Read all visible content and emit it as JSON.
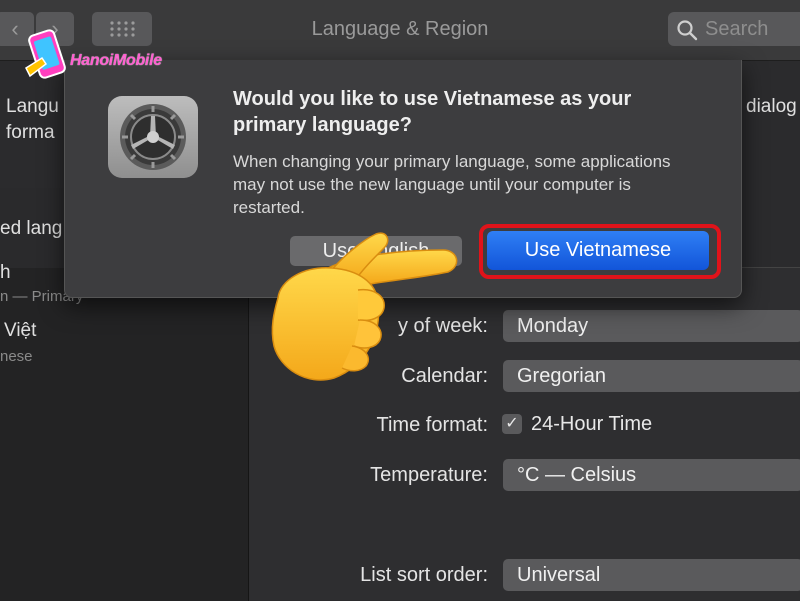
{
  "window": {
    "title": "Language & Region",
    "search_placeholder": "Search"
  },
  "watermark": {
    "brand": "HanoiMobile"
  },
  "background": {
    "header_line1": "Langu",
    "header_line2": "forma",
    "header_right": "dialog",
    "sidebar_heading": "ed lang",
    "languages": [
      {
        "name": "h",
        "sub": "n — Primary"
      },
      {
        "name": "Việt",
        "sub": "nese"
      }
    ],
    "settings": [
      {
        "label": "y of week:",
        "value": "Monday"
      },
      {
        "label": "Calendar:",
        "value": "Gregorian"
      },
      {
        "label": "Time format:",
        "value": "24-Hour Time",
        "checked": true
      },
      {
        "label": "Temperature:",
        "value": "°C — Celsius"
      },
      {
        "label": "List sort order:",
        "value": "Universal"
      }
    ]
  },
  "dialog": {
    "title": "Would you like to use Vietnamese as your primary language?",
    "message": "When changing your primary language, some applications may not use the new language until your computer is restarted.",
    "secondary_button": "Use English",
    "primary_button": "Use Vietnamese",
    "icon": "system-preferences-gear-icon",
    "highlight_color": "#e0131a",
    "primary_color": "#1e6bf0"
  },
  "overlay": {
    "icon": "pointing-hand-emoji"
  }
}
